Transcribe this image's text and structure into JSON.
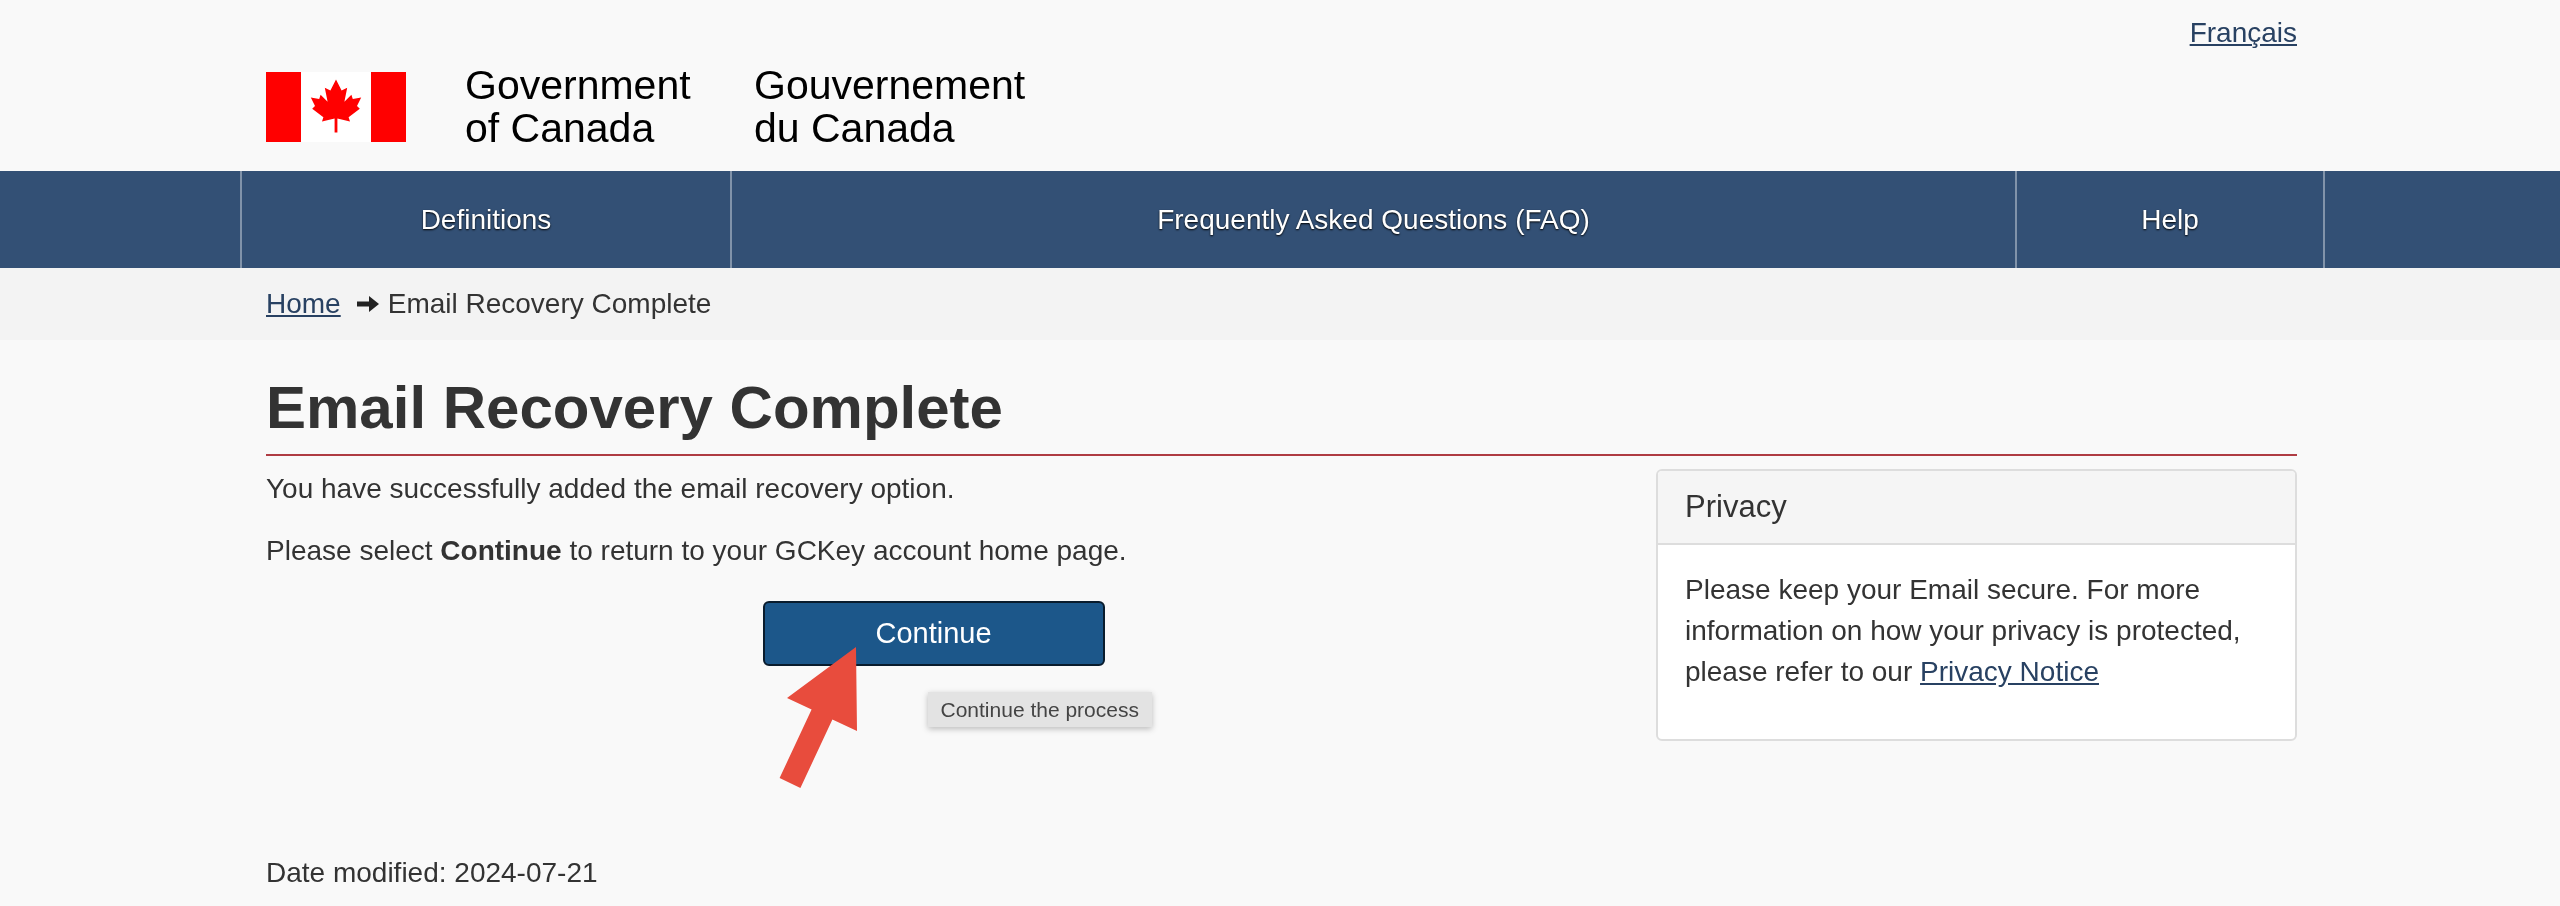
{
  "header": {
    "language_link": "Français",
    "signature_en": "Government of Canada",
    "signature_fr": "Gouvernement du Canada"
  },
  "nav": [
    {
      "label": "Definitions"
    },
    {
      "label": "Frequently Asked Questions (FAQ)"
    },
    {
      "label": "Help"
    }
  ],
  "breadcrumb": [
    {
      "label": "Home",
      "kind": "link"
    },
    {
      "label": "Email Recovery Complete",
      "kind": "current"
    }
  ],
  "main": {
    "title": "Email Recovery Complete",
    "paragraphs": [
      "You have successfully added the email recovery option.",
      "Please select **Continue** to return to your GCKey account home page."
    ],
    "button": {
      "label": "Continue",
      "tooltip": "Continue the process"
    }
  },
  "privacy_panel": {
    "title": "Privacy",
    "text": "Please keep your Email secure. For more information on how your privacy is protected, please refer to our",
    "link": "Privacy Notice"
  },
  "footer": {
    "date_modified": "Date modified: 2024-07-21"
  }
}
